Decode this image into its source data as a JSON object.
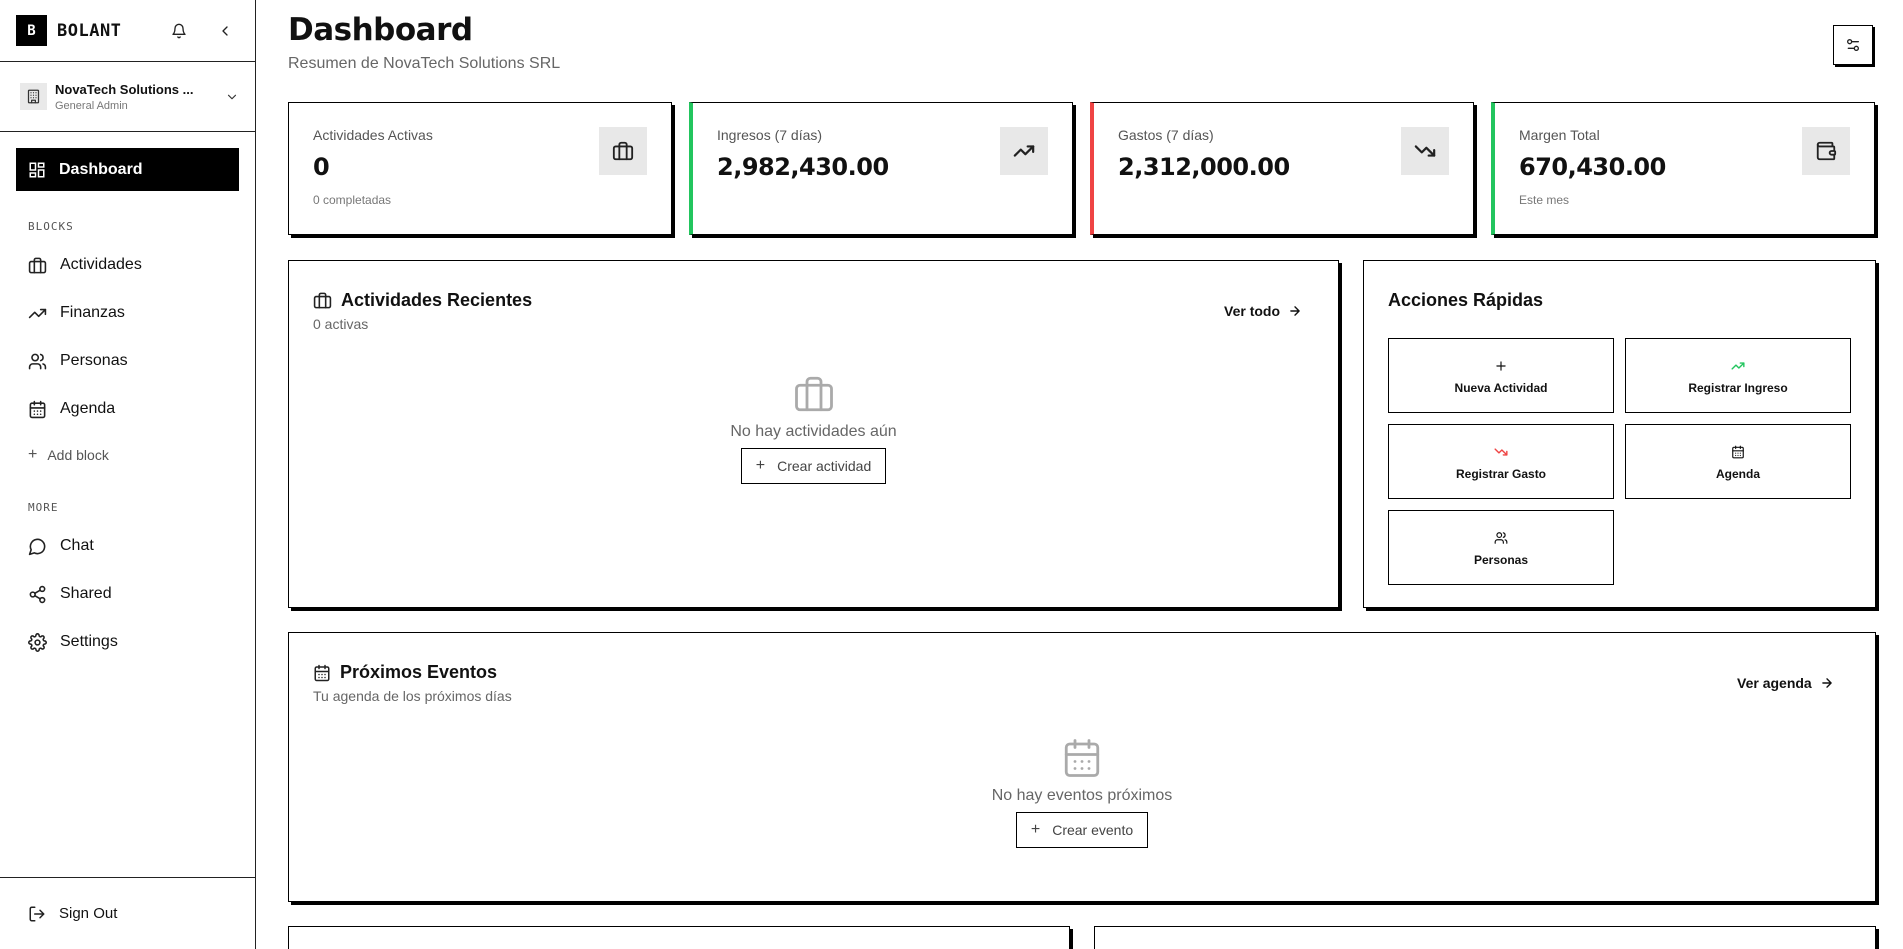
{
  "brand": {
    "logo_letter": "B",
    "name": "BOLANT"
  },
  "org": {
    "name": "NovaTech Solutions ...",
    "role": "General Admin"
  },
  "nav": {
    "active_label": "Dashboard",
    "blocks_label": "BLOCKS",
    "blocks": [
      {
        "label": "Actividades",
        "icon": "briefcase-icon"
      },
      {
        "label": "Finanzas",
        "icon": "trending-up-icon"
      },
      {
        "label": "Personas",
        "icon": "users-icon"
      },
      {
        "label": "Agenda",
        "icon": "calendar-icon"
      }
    ],
    "add_block": "Add block",
    "more_label": "MORE",
    "more": [
      {
        "label": "Chat",
        "icon": "chat-icon"
      },
      {
        "label": "Shared",
        "icon": "share-icon"
      },
      {
        "label": "Settings",
        "icon": "gear-icon"
      }
    ],
    "sign_out": "Sign Out"
  },
  "header": {
    "title": "Dashboard",
    "subtitle": "Resumen de NovaTech Solutions SRL"
  },
  "stats": [
    {
      "label": "Actividades Activas",
      "value": "0",
      "sub": "0 completadas",
      "accent": "#000000",
      "icon": "briefcase-icon"
    },
    {
      "label": "Ingresos (7 días)",
      "value": "2,982,430.00",
      "sub": "",
      "accent": "#22c55e",
      "icon": "trending-up-icon"
    },
    {
      "label": "Gastos (7 días)",
      "value": "2,312,000.00",
      "sub": "",
      "accent": "#ef4444",
      "icon": "trending-down-icon"
    },
    {
      "label": "Margen Total",
      "value": "670,430.00",
      "sub": "Este mes",
      "accent": "#22c55e",
      "icon": "wallet-icon"
    }
  ],
  "recent": {
    "title": "Actividades Recientes",
    "subtitle": "0 activas",
    "link": "Ver todo",
    "empty_text": "No hay actividades aún",
    "empty_button": "Crear actividad"
  },
  "quick_actions": {
    "title": "Acciones Rápidas",
    "items": [
      {
        "label": "Nueva Actividad",
        "icon": "plus-icon"
      },
      {
        "label": "Registrar Ingreso",
        "icon": "trending-up-icon"
      },
      {
        "label": "Registrar Gasto",
        "icon": "trending-down-icon"
      },
      {
        "label": "Agenda",
        "icon": "calendar-icon"
      },
      {
        "label": "Personas",
        "icon": "users-icon"
      }
    ]
  },
  "events": {
    "title": "Próximos Eventos",
    "subtitle": "Tu agenda de los próximos días",
    "link": "Ver agenda",
    "empty_text": "No hay eventos próximos",
    "empty_button": "Crear evento"
  }
}
